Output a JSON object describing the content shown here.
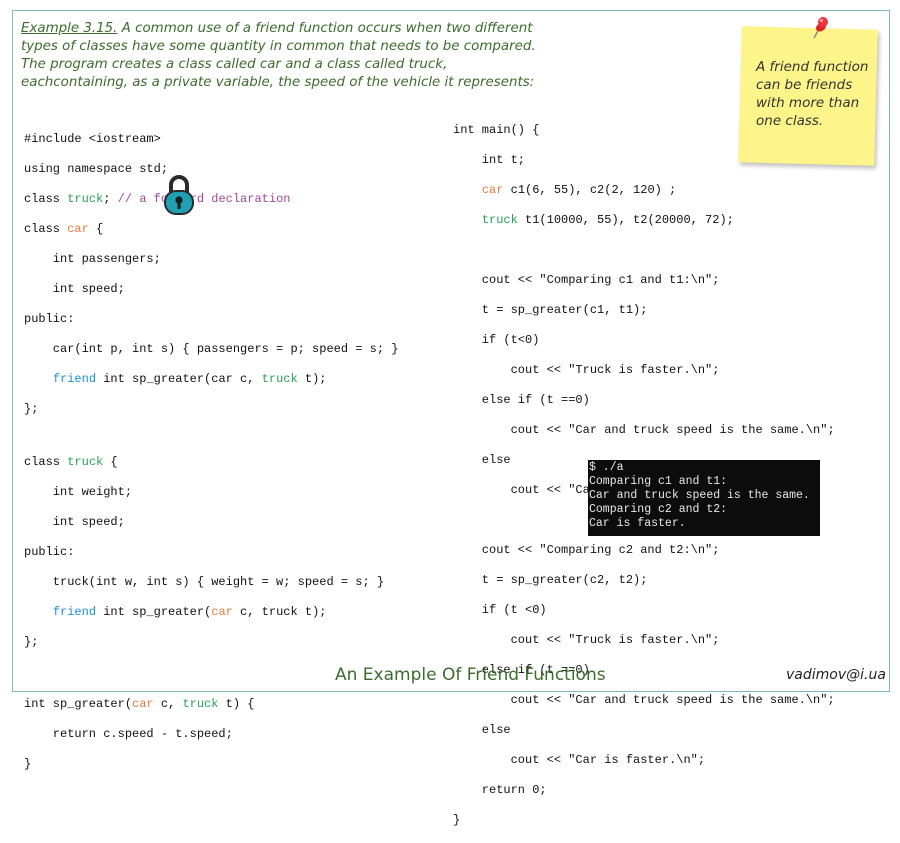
{
  "intro": {
    "example_label": "Example 3.15.",
    "text": " A common use of a friend function occurs when two different types of classes have some quantity in common that needs to be compared. The program creates a class called car and a class called truck, eachcontaining, as a private variable, the speed of the vehicle it represents:"
  },
  "left_code": {
    "l1": "#include <iostream>",
    "l2": "using namespace std;",
    "l3a": "class ",
    "l3b": "truck",
    "l3c": "; ",
    "l3d": "// a forward declaration",
    "l4a": "class ",
    "l4b": "car",
    "l4c": " {",
    "l5": "    int passengers;",
    "l6": "    int speed;",
    "l7": "public:",
    "l8": "    car(int p, int s) { passengers = p; speed = s; }",
    "l9a": "    ",
    "l9b": "friend",
    "l9c": " int sp_greater(car c, ",
    "l9d": "truck",
    "l9e": " t);",
    "l10": "};",
    "l11a": "class ",
    "l11b": "truck",
    "l11c": " {",
    "l12": "    int weight;",
    "l13": "    int speed;",
    "l14": "public:",
    "l15": "    truck(int w, int s) { weight = w; speed = s; }",
    "l16a": "    ",
    "l16b": "friend",
    "l16c": " int sp_greater(",
    "l16d": "car",
    "l16e": " c, truck t);",
    "l17": "};",
    "l18a": "int sp_greater(",
    "l18b": "car",
    "l18c": " c, ",
    "l18d": "truck",
    "l18e": " t) {",
    "l19": "    return c.speed - t.speed;",
    "l20": "}"
  },
  "right_code": {
    "r1": "int main() {",
    "r2": "    int t;",
    "r3a": "    ",
    "r3b": "car",
    "r3c": " c1(6, 55), c2(2, 120) ;",
    "r4a": "    ",
    "r4b": "truck",
    "r4c": " t1(10000, 55), t2(20000, 72);",
    "r5": "    cout << \"Comparing c1 and t1:\\n\";",
    "r6": "    t = sp_greater(c1, t1);",
    "r7": "    if (t<0)",
    "r8": "        cout << \"Truck is faster.\\n\";",
    "r9": "    else if (t ==0)",
    "r10": "        cout << \"Car and truck speed is the same.\\n\";",
    "r11": "    else",
    "r12": "        cout << \"Car is faster.\\n\";",
    "r13": "    cout << \"Comparing c2 and t2:\\n\";",
    "r14": "    t = sp_greater(c2, t2);",
    "r15": "    if (t <0)",
    "r16": "        cout << \"Truck is faster.\\n\";",
    "r17": "    else if (t ==0)",
    "r18": "        cout << \"Car and truck speed is the same.\\n\";",
    "r19": "    else",
    "r20": "        cout << \"Car is faster.\\n\";",
    "r21": "    return 0;",
    "r22": "}"
  },
  "note": {
    "text": "A friend function can be friends with more than one class."
  },
  "terminal": {
    "t1": "$ ./a",
    "t2": "Comparing c1 and t1:",
    "t3": "Car and truck speed is the same.",
    "t4": "Comparing c2 and t2:",
    "t5": "Car is faster."
  },
  "footer": {
    "title": "An Example Of Friend Functions",
    "email": "vadimov@i.ua"
  },
  "icons": {
    "lock": "padlock-icon",
    "pin": "pushpin-icon"
  },
  "colors": {
    "intro_text": "#3c6b2c",
    "keyword_orange": "#e57a3c",
    "keyword_green": "#27a15c",
    "keyword_blue": "#1b8fd6",
    "comment_purple": "#a3479f",
    "note_bg": "#fdf58a",
    "lock_teal": "#1f9fb0",
    "terminal_bg": "#0c0c0c"
  }
}
